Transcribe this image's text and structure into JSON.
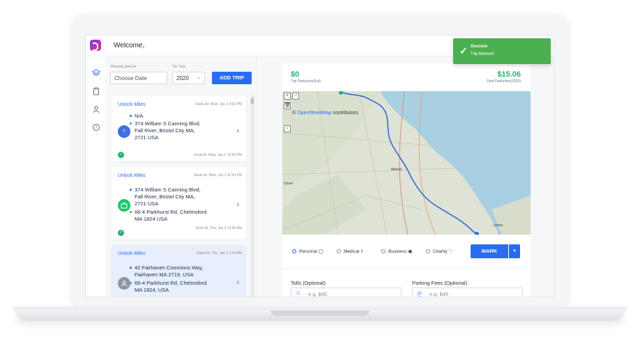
{
  "header": {
    "welcome": "Welcome,"
  },
  "sidebar": {
    "icons": [
      "layers-icon",
      "clipboard-icon",
      "user-icon",
      "help-icon"
    ]
  },
  "filters": {
    "showing_label": "Showing data for",
    "date_placeholder": "Choose Date",
    "tax_year_label": "Tax Year",
    "tax_year_value": "2020",
    "add_trip_label": "ADD TRIP"
  },
  "trips": [
    {
      "title": "Unlock Miles",
      "starts": "Starts At: Wed, Jan 1 9:52 PM",
      "from": "N/A",
      "to": [
        "374 William S Canning Blvd,",
        "Fall River, Bristol City MA,",
        "2721 USA"
      ],
      "ends": "Ends At: Wed, Jan 1 10:49 PM",
      "avatar_text": "🏥",
      "avatar_color": "#3f6fe0"
    },
    {
      "title": "Unlock Miles",
      "starts": "Starts At: Wed, Jan 1 11:53 PM",
      "from": [
        "374 William S Canning Blvd,",
        "Fall River, Bristol City MA,",
        "2721 USA"
      ],
      "to": [
        "66-4 Parkhurst Rd, Chelmsford",
        "MA 1824 USA"
      ],
      "ends": "Ends At: Thu, Jan 2 12:46 AM",
      "avatar_text": "💼",
      "avatar_color": "#1fc46e"
    },
    {
      "title": "Unlock Miles",
      "starts": "Starts At: Thu, Jan 2 1:42 AM",
      "from": [
        "42 Fairhaven Commons Way,",
        "Fairhaven MA 2719, USA"
      ],
      "to": [
        "66-4 Parkhurst Rd, Chelmsford",
        "MA 1824, USA"
      ],
      "avatar_text": "👤",
      "avatar_color": "#8d96a5"
    }
  ],
  "summary": {
    "trip_value": "$0",
    "trip_label": "Trip Deduction(Est)",
    "total_value": "$15.06",
    "total_label": "Total Deduction(2020)"
  },
  "map": {
    "zoom_in": "+",
    "zoom_out": "−",
    "attribution_prefix": "© ",
    "attribution_link": "OpenStreetMap",
    "attribution_suffix": " contributors",
    "place_labels": [
      "Milford",
      "Lewes",
      "Dover"
    ]
  },
  "types": [
    {
      "label": "Personal",
      "icon": "👤",
      "selected": true
    },
    {
      "label": "Medical",
      "icon": "🏥",
      "selected": false
    },
    {
      "label": "Business",
      "icon": "💼",
      "selected": false
    },
    {
      "label": "Charity",
      "icon": "♡",
      "selected": false
    }
  ],
  "mark_label": "MARK",
  "fields": {
    "tolls_label": "Tolls (Optional)",
    "tolls_placeholder": "e.g. $45",
    "parking_label": "Parking Fees (Optional)",
    "parking_placeholder": "e.g. $45"
  },
  "toast": {
    "title": "Success",
    "message": "Trip Marked!"
  },
  "colors": {
    "accent": "#2a6bf2",
    "success": "#1fb46a",
    "toast": "#4caf50"
  }
}
